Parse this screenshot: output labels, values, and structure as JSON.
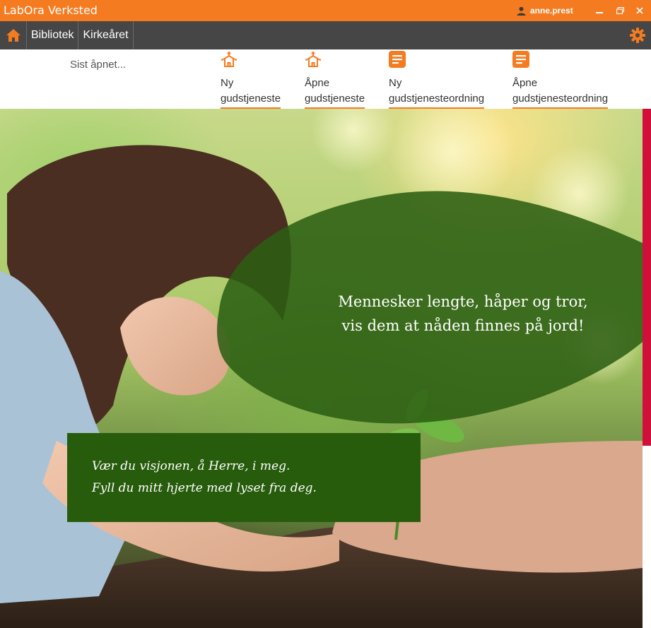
{
  "window": {
    "title": "LabOra Verksted",
    "user": "anne.prest"
  },
  "nav": {
    "items": [
      "Bibliotek",
      "Kirkeåret"
    ]
  },
  "toolbar": {
    "recent_label": "Sist åpnet...",
    "actions": [
      {
        "line1": "Ny",
        "line2": "gudstjeneste",
        "icon": "church-icon"
      },
      {
        "line1": "Åpne",
        "line2": "gudstjeneste",
        "icon": "church-icon"
      },
      {
        "line1": "Ny",
        "line2": "gudstjenesteordning",
        "icon": "document-icon"
      },
      {
        "line1": "Åpne",
        "line2": "gudstjenesteordning",
        "icon": "document-icon"
      }
    ]
  },
  "hero": {
    "quote_line1": "Mennesker lengte, håper og tror,",
    "quote_line2": "vis dem at nåden finnes på jord!",
    "verse_line1": "Vær du visjonen, å Herre, i meg.",
    "verse_line2": "Fyll du mitt hjerte med lyset fra deg."
  },
  "colors": {
    "accent": "#f47b20",
    "navbar": "#464646",
    "leaf_green": "#2c5e12",
    "box_green": "#275c0c",
    "scrollbar": "#d0103a"
  }
}
